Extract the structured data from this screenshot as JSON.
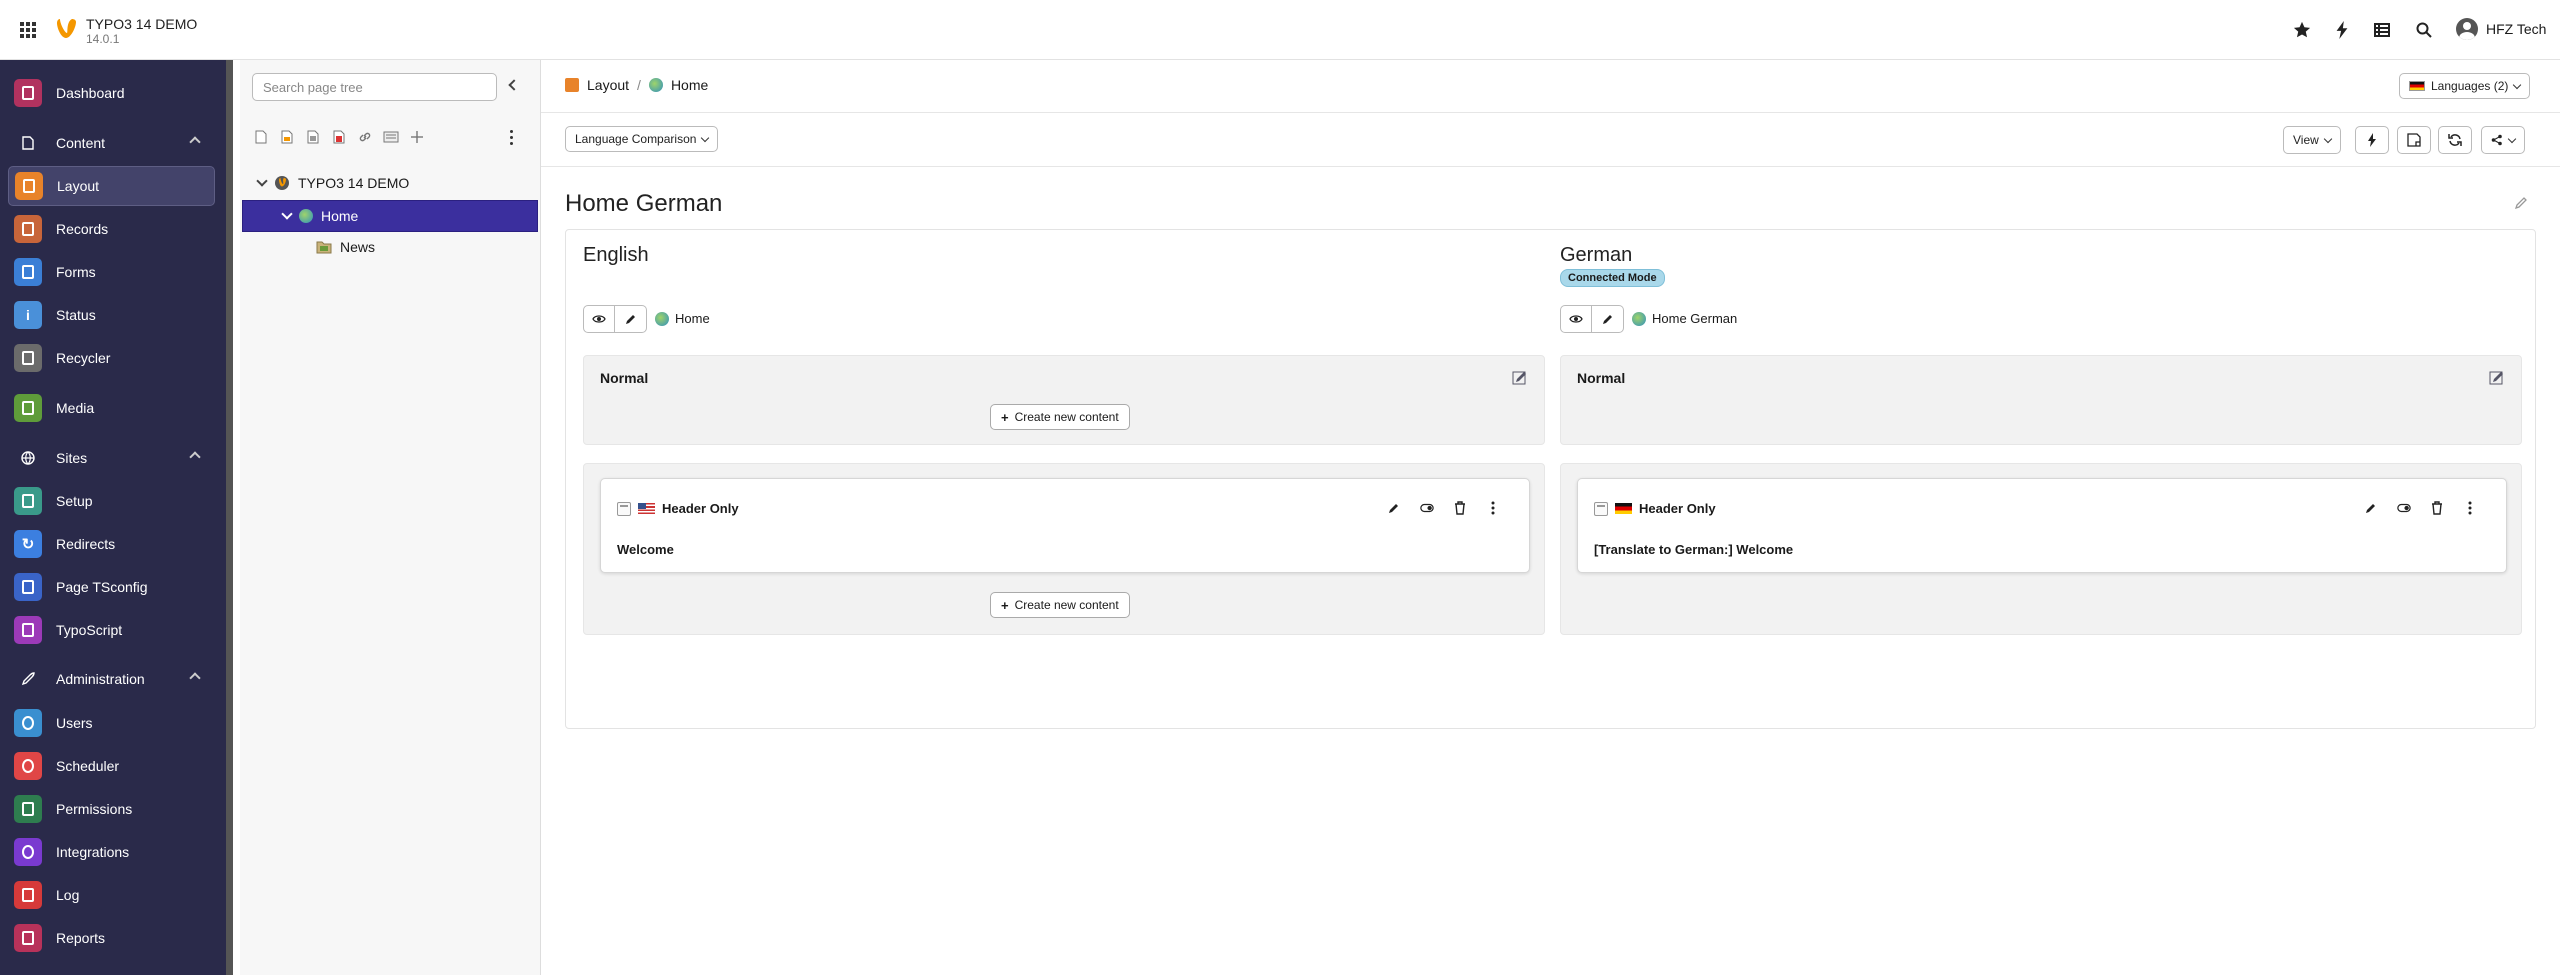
{
  "topbar": {
    "site_name": "TYPO3 14 DEMO",
    "version": "14.0.1",
    "user_name": "HFZ Tech",
    "icons": [
      "apps-grid-icon",
      "typo3-logo-icon",
      "bookmark-star-icon",
      "flash-icon",
      "list-icon",
      "search-icon",
      "user-avatar-icon"
    ]
  },
  "modules": {
    "dashboard": "Dashboard",
    "content_group": "Content",
    "layout": "Layout",
    "records": "Records",
    "forms": "Forms",
    "status": "Status",
    "recycler": "Recycler",
    "media": "Media",
    "sites_group": "Sites",
    "setup": "Setup",
    "redirects": "Redirects",
    "page_tsconfig": "Page TSconfig",
    "typoscript": "TypoScript",
    "admin_group": "Administration",
    "users": "Users",
    "scheduler": "Scheduler",
    "permissions": "Permissions",
    "integrations": "Integrations",
    "log": "Log",
    "reports": "Reports"
  },
  "pagetree": {
    "search_placeholder": "Search page tree",
    "root": "TYPO3 14 DEMO",
    "home": "Home",
    "news": "News"
  },
  "header": {
    "crumb_module": "Layout",
    "crumb_separator": "/",
    "crumb_page": "Home",
    "languages_button": "Languages (2)",
    "mode_select": "Language Comparison",
    "view_button": "View"
  },
  "page": {
    "title": "Home German"
  },
  "columns": {
    "english": {
      "heading": "English",
      "page_link": "Home",
      "colpos_name": "Normal",
      "create_label": "Create new content",
      "create_label_2": "Create new content",
      "card_type": "Header Only",
      "card_body": "Welcome"
    },
    "german": {
      "heading": "German",
      "badge": "Connected Mode",
      "page_link": "Home German",
      "colpos_name": "Normal",
      "card_type": "Header Only",
      "card_body": "[Translate to German:] Welcome"
    }
  },
  "colors": {
    "module_menu_bg": "#2a2a4a",
    "tree_selected": "#3b2f9e",
    "badge_bg": "#a9d8ea",
    "typo3_orange": "#f49700"
  }
}
